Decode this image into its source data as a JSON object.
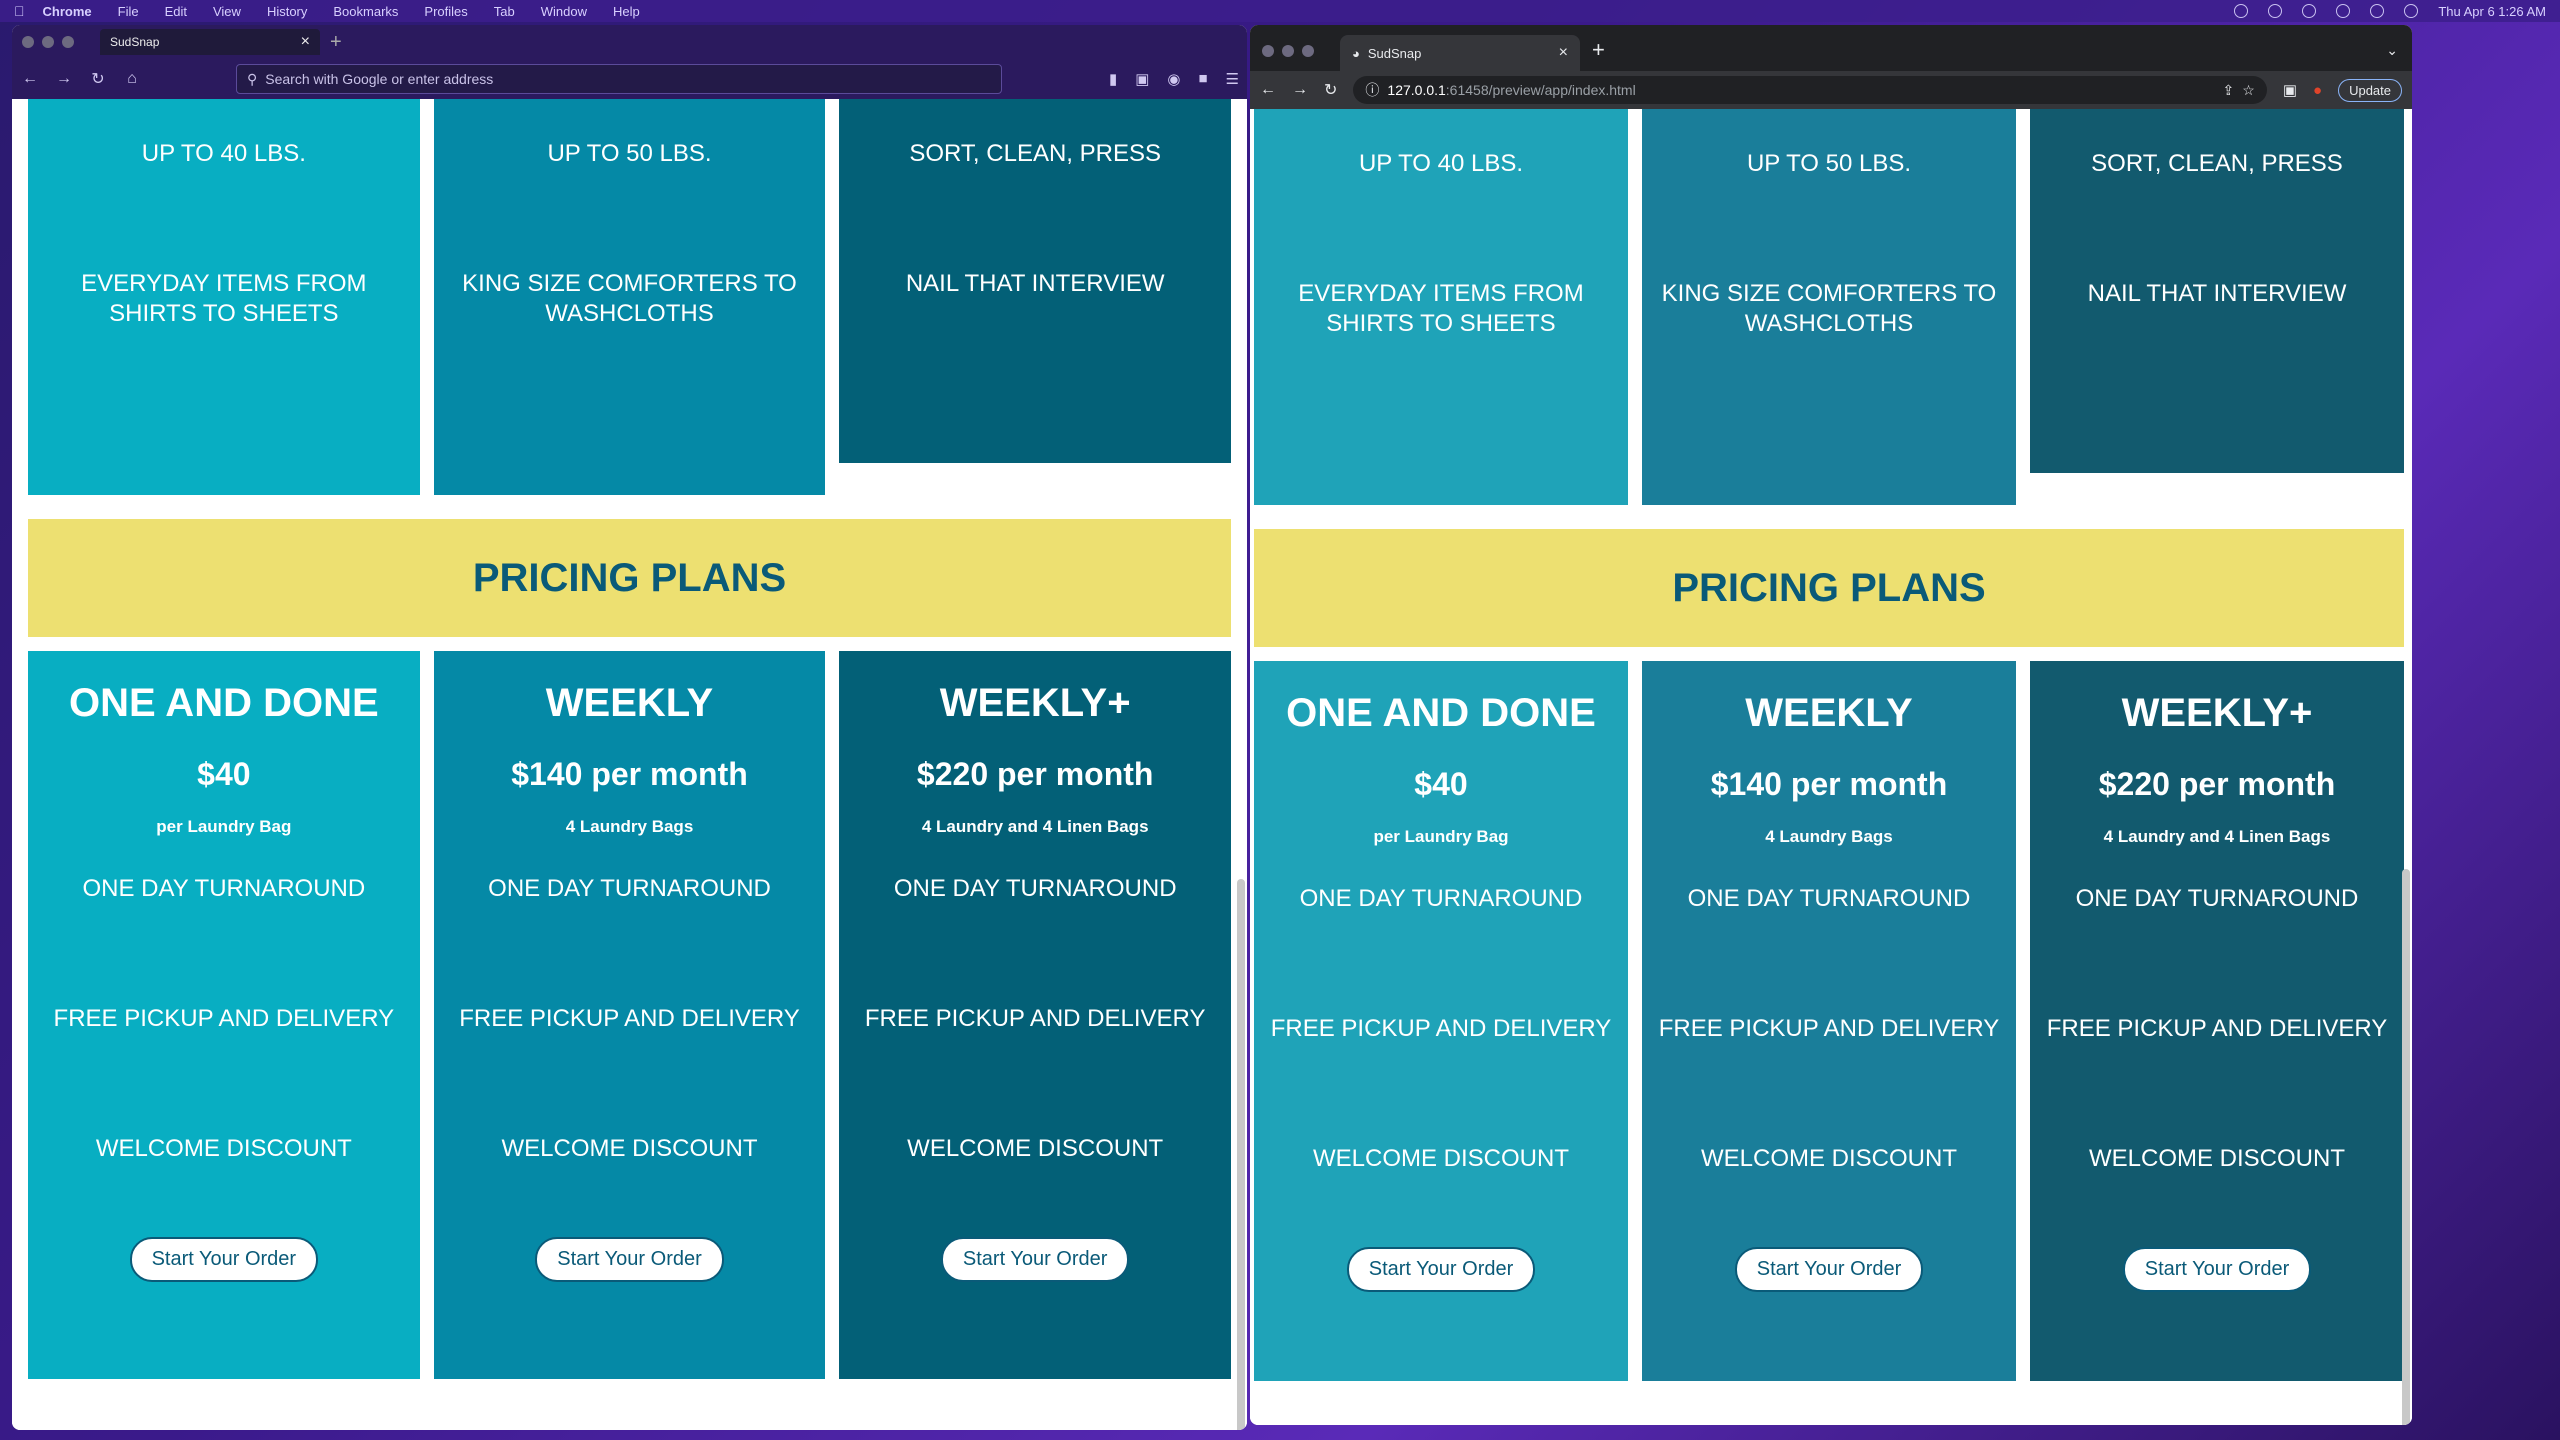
{
  "menubar": {
    "app": "Chrome",
    "items": [
      "File",
      "Edit",
      "View",
      "History",
      "Bookmarks",
      "Profiles",
      "Tab",
      "Window",
      "Help"
    ],
    "clock": "Thu Apr 6  1:26 AM"
  },
  "left_browser": {
    "tab_title": "SudSnap",
    "url_placeholder": "Search with Google or enter address"
  },
  "right_browser": {
    "tab_title": "SudSnap",
    "url_host": "127.0.0.1",
    "url_path": ":61458/preview/app/index.html",
    "update_label": "Update"
  },
  "features": [
    {
      "line1": "UP TO 40 LBS.",
      "line2": "EVERYDAY ITEMS FROM SHIRTS TO SHEETS"
    },
    {
      "line1": "UP TO 50 LBS.",
      "line2": "KING SIZE COMFORTERS TO WASHCLOTHS"
    },
    {
      "line1": "SORT, CLEAN, PRESS",
      "line2": "NAIL THAT INTERVIEW"
    }
  ],
  "pricing_title": "PRICING PLANS",
  "plans": [
    {
      "name": "ONE AND DONE",
      "price": "$40",
      "note": "per Laundry Bag",
      "f1": "ONE DAY TURNAROUND",
      "f2": "FREE PICKUP AND DELIVERY",
      "f3": "WELCOME DISCOUNT",
      "button": "Start Your Order"
    },
    {
      "name": "WEEKLY",
      "price": "$140 per month",
      "note": "4 Laundry Bags",
      "f1": "ONE DAY TURNAROUND",
      "f2": "FREE PICKUP AND DELIVERY",
      "f3": "WELCOME DISCOUNT",
      "button": "Start Your Order"
    },
    {
      "name": "WEEKLY+",
      "price": "$220 per month",
      "note": "4 Laundry and 4 Linen Bags",
      "f1": "ONE DAY TURNAROUND",
      "f2": "FREE PICKUP AND DELIVERY",
      "f3": "WELCOME DISCOUNT",
      "button": "Start Your Order"
    }
  ],
  "colors": {
    "card1": "#08aec2",
    "card2": "#0589a6",
    "card3": "#036077",
    "banner": "#ede071",
    "banner_text": "#0a5a78"
  }
}
